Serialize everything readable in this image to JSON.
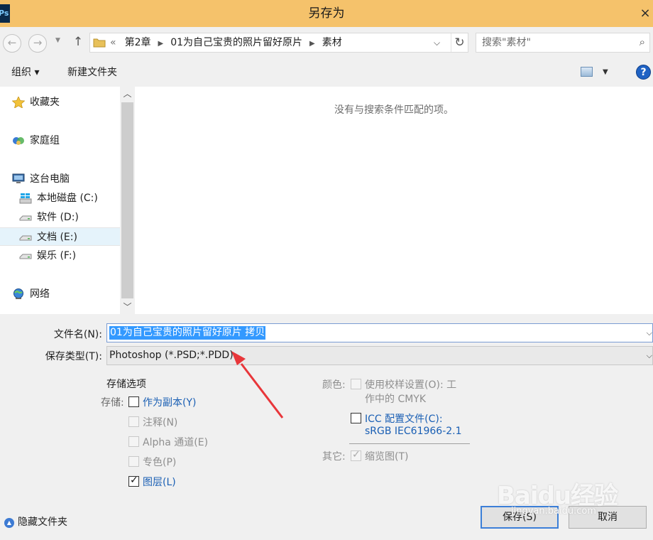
{
  "window": {
    "title": "另存为",
    "close_glyph": "×",
    "app_badge": "Ps"
  },
  "address": {
    "overflow_marker": "«",
    "crumbs": [
      "第2章",
      "01为自己宝贵的照片留好原片",
      "素材"
    ],
    "search_placeholder": "搜索\"素材\""
  },
  "toolbar": {
    "organize_label": "组织 ▾",
    "new_folder_label": "新建文件夹",
    "help_glyph": "?"
  },
  "sidebar": {
    "items": [
      {
        "label": "收藏夹",
        "icon": "star-icon"
      },
      {
        "label": "家庭组",
        "icon": "homegroup-icon"
      },
      {
        "label": "这台电脑",
        "icon": "computer-icon"
      },
      {
        "label": "本地磁盘 (C:)",
        "icon": "windows-drive-icon"
      },
      {
        "label": "软件 (D:)",
        "icon": "drive-icon"
      },
      {
        "label": "文档 (E:)",
        "icon": "drive-icon",
        "selected": true
      },
      {
        "label": "娱乐 (F:)",
        "icon": "drive-icon"
      },
      {
        "label": "网络",
        "icon": "network-icon"
      }
    ]
  },
  "content": {
    "empty_message": "没有与搜索条件匹配的项。"
  },
  "form": {
    "filename_label": "文件名(N):",
    "filename_value": "01为自己宝贵的照片留好原片 拷贝",
    "filetype_label": "保存类型(T):",
    "filetype_value": "Photoshop (*.PSD;*.PDD)"
  },
  "save_options": {
    "heading": "存储选项",
    "save_label": "存储:",
    "as_copy": {
      "label": "作为副本(Y)",
      "checked": false
    },
    "annotations": {
      "label": "注释(N)",
      "checked": false,
      "enabled": false
    },
    "alpha": {
      "label": "Alpha 通道(E)",
      "checked": false,
      "enabled": false
    },
    "spot": {
      "label": "专色(P)",
      "checked": false,
      "enabled": false
    },
    "layers": {
      "label": "图层(L)",
      "checked": true
    },
    "color_label": "颜色:",
    "proof_line1": "使用校样设置(O): 工",
    "proof_line2": "作中的 CMYK",
    "icc_line1": "ICC 配置文件(C):",
    "icc_line2": "sRGB IEC61966-2.1",
    "other_label": "其它:",
    "thumbnail": {
      "label": "缩览图(T)",
      "checked": true,
      "enabled": false
    }
  },
  "footer": {
    "hide_folders": "隐藏文件夹",
    "save_button": "保存(S)",
    "cancel_button": "取消"
  },
  "watermark": {
    "text": "Baidu经验",
    "url": "jingyan.baidu.com"
  }
}
